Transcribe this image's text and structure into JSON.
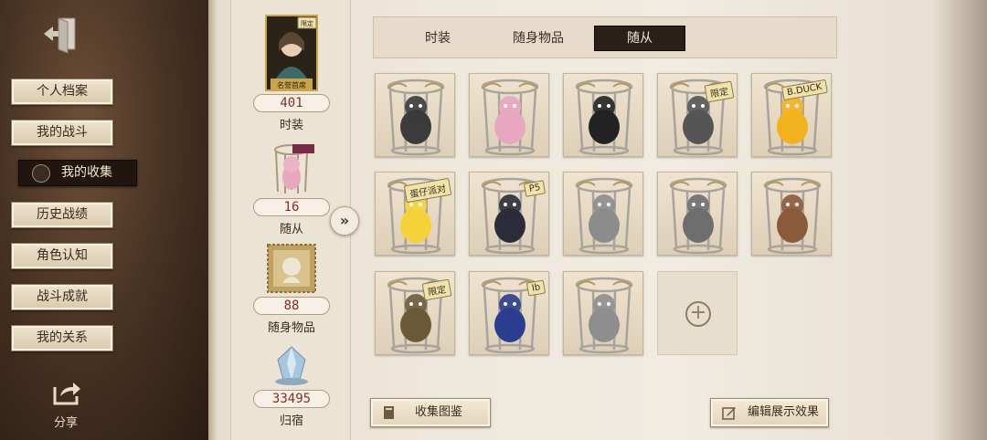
{
  "sidebar": {
    "items": [
      {
        "label": "个人档案",
        "active": false
      },
      {
        "label": "我的战斗",
        "active": false
      },
      {
        "label": "我的收集",
        "active": true
      },
      {
        "label": "历史战绩",
        "active": false
      },
      {
        "label": "角色认知",
        "active": false
      },
      {
        "label": "战斗成就",
        "active": false
      },
      {
        "label": "我的关系",
        "active": false
      }
    ],
    "share_label": "分享",
    "exit_icon": "exit-door-icon"
  },
  "stats": {
    "costume": {
      "count": "401",
      "label": "时装",
      "thumb_badge": "限定",
      "thumb_caption": "名誉首席"
    },
    "companion": {
      "count": "16",
      "label": "随从"
    },
    "accessory": {
      "count": "88",
      "label": "随身物品"
    },
    "home": {
      "count": "33495",
      "label": "归宿"
    }
  },
  "tabs": [
    {
      "label": "时装",
      "active": false
    },
    {
      "label": "随身物品",
      "active": false
    },
    {
      "label": "随从",
      "active": true
    }
  ],
  "grid": {
    "items": [
      {
        "name": "companion-robot",
        "badge": "",
        "accent": "#3b3b3b"
      },
      {
        "name": "companion-pink-bear",
        "badge": "",
        "accent": "#e7a7be"
      },
      {
        "name": "companion-panda",
        "badge": "",
        "accent": "#222222"
      },
      {
        "name": "companion-gear-doll",
        "badge": "限定",
        "accent": "#555555"
      },
      {
        "name": "companion-duck",
        "badge": "B.DUCK",
        "accent": "#f2b21e"
      },
      {
        "name": "companion-egg-blob",
        "badge": "蛋仔派对",
        "accent": "#f5d23a"
      },
      {
        "name": "companion-black-cat",
        "badge": "P5",
        "accent": "#2b2b3a"
      },
      {
        "name": "companion-rabbit",
        "badge": "",
        "accent": "#8c8c8c"
      },
      {
        "name": "companion-tabby-cat",
        "badge": "",
        "accent": "#6e6e6e"
      },
      {
        "name": "companion-reindeer",
        "badge": "",
        "accent": "#8a5a3a"
      },
      {
        "name": "companion-gecko",
        "badge": "限定",
        "accent": "#6b5a3a"
      },
      {
        "name": "companion-blue-doll",
        "badge": "Ib",
        "accent": "#2a3d8e"
      },
      {
        "name": "companion-owl-king",
        "badge": "",
        "accent": "#8e8e8e"
      }
    ],
    "add_icon": "plus-icon"
  },
  "buttons": {
    "collection_guide": "收集图鉴",
    "edit_display": "编辑展示效果"
  },
  "colors": {
    "count_red": "#8e2a22",
    "active_dark": "#20160f",
    "paper": "#efe8dc"
  }
}
